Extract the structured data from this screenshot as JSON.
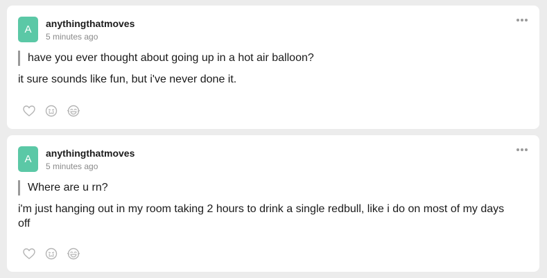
{
  "posts": [
    {
      "avatar_letter": "A",
      "username": "anythingthatmoves",
      "timestamp": "5 minutes ago",
      "quote": "have you ever thought about going up in a hot air balloon?",
      "reply": "it sure sounds like fun, but i've never done it."
    },
    {
      "avatar_letter": "A",
      "username": "anythingthatmoves",
      "timestamp": "5 minutes ago",
      "quote": "Where are u rn?",
      "reply": "i'm just hanging out in my room taking 2 hours to drink a single redbull, like i do on most of my days off"
    }
  ],
  "icons": {
    "more": "more-options-icon",
    "like": "heart-icon",
    "sad": "sad-face-icon",
    "laugh": "laughing-face-icon"
  },
  "colors": {
    "background": "#ececec",
    "card": "#ffffff",
    "avatar": "#5bc8a6",
    "icon": "#b4b4b4",
    "quote_bar": "#9a9a9a"
  }
}
